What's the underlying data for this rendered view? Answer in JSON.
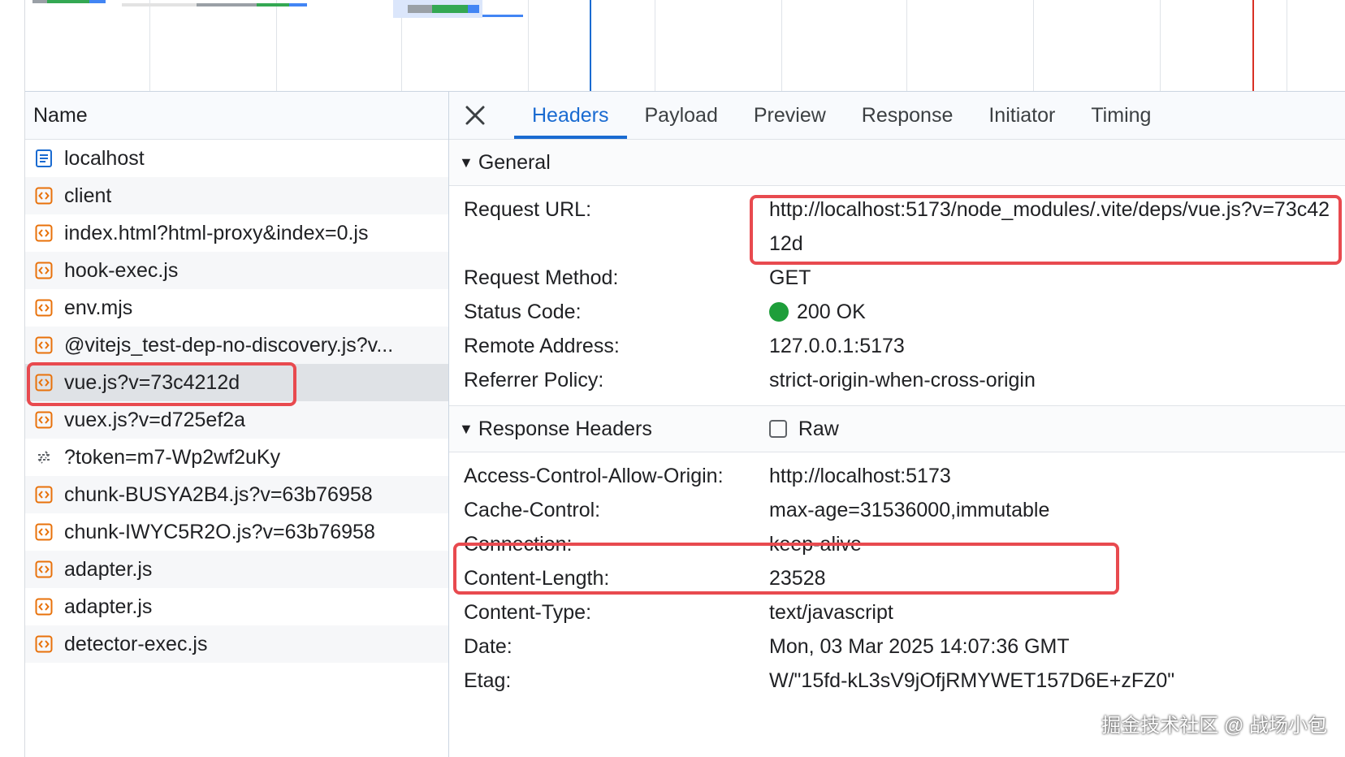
{
  "list_header": "Name",
  "requests": [
    {
      "name": "localhost",
      "icon": "document-icon"
    },
    {
      "name": "client",
      "icon": "script-icon"
    },
    {
      "name": "index.html?html-proxy&index=0.js",
      "icon": "script-icon"
    },
    {
      "name": "hook-exec.js",
      "icon": "script-icon"
    },
    {
      "name": "env.mjs",
      "icon": "script-icon"
    },
    {
      "name": "@vitejs_test-dep-no-discovery.js?v...",
      "icon": "script-icon"
    },
    {
      "name": "vue.js?v=73c4212d",
      "icon": "script-icon",
      "selected": true
    },
    {
      "name": "vuex.js?v=d725ef2a",
      "icon": "script-icon"
    },
    {
      "name": "?token=m7-Wp2wf2uKy",
      "icon": "websocket-icon"
    },
    {
      "name": "chunk-BUSYA2B4.js?v=63b76958",
      "icon": "script-icon"
    },
    {
      "name": "chunk-IWYC5R2O.js?v=63b76958",
      "icon": "script-icon"
    },
    {
      "name": "adapter.js",
      "icon": "script-icon"
    },
    {
      "name": "adapter.js",
      "icon": "script-icon"
    },
    {
      "name": "detector-exec.js",
      "icon": "script-icon"
    }
  ],
  "tabs": [
    {
      "label": "Headers",
      "active": true
    },
    {
      "label": "Payload"
    },
    {
      "label": "Preview"
    },
    {
      "label": "Response"
    },
    {
      "label": "Initiator"
    },
    {
      "label": "Timing"
    }
  ],
  "general": {
    "title": "General",
    "rows": [
      {
        "key": "Request URL:",
        "value": "http://localhost:5173/node_modules/.vite/deps/vue.js?v=73c4212d"
      },
      {
        "key": "Request Method:",
        "value": "GET"
      },
      {
        "key": "Status Code:",
        "value": "200 OK"
      },
      {
        "key": "Remote Address:",
        "value": "127.0.0.1:5173"
      },
      {
        "key": "Referrer Policy:",
        "value": "strict-origin-when-cross-origin"
      }
    ]
  },
  "response_headers": {
    "title": "Response Headers",
    "raw_label": "Raw",
    "raw_checked": false,
    "rows": [
      {
        "key": "Access-Control-Allow-Origin:",
        "value": "http://localhost:5173"
      },
      {
        "key": "Cache-Control:",
        "value": "max-age=31536000,immutable"
      },
      {
        "key": "Connection:",
        "value": "keep-alive"
      },
      {
        "key": "Content-Length:",
        "value": "23528"
      },
      {
        "key": "Content-Type:",
        "value": "text/javascript"
      },
      {
        "key": "Date:",
        "value": "Mon, 03 Mar 2025 14:07:36 GMT"
      },
      {
        "key": "Etag:",
        "value": "W/\"15fd-kL3sV9jOfjRMYWET157D6E+zFZ0\""
      }
    ]
  },
  "colors": {
    "accent": "#1a6bd1",
    "highlight": "#e84a4f",
    "status_ok": "#1e9e3a",
    "script_icon": "#e8710a",
    "document_icon": "#1a6bd1"
  },
  "watermark": "掘金技术社区 @ 战场小包"
}
